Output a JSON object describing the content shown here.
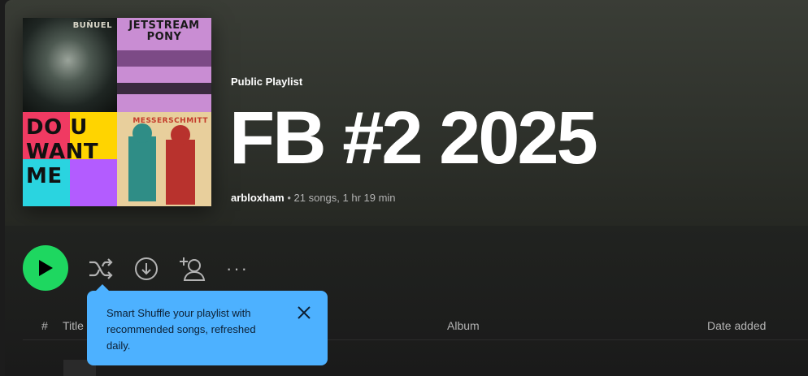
{
  "playlist": {
    "type_label": "Public Playlist",
    "title": "FB #2 2025",
    "owner": "arbloxham",
    "meta": " • 21 songs, 1 hr 19 min"
  },
  "cover": {
    "tile1_text": "BUÑUEL",
    "tile2_text_line1": "JETSTREAM",
    "tile2_text_line2": "PONY",
    "tile3_text": "DO U WANT ME",
    "tile4_text": "MESSERSCHMITT"
  },
  "actions": {
    "play_icon": "play-icon",
    "shuffle_icon": "shuffle-icon",
    "download_icon": "download-icon",
    "add_user_icon": "add-user-icon",
    "more_icon": "more-icon",
    "more_text": "···"
  },
  "tooltip": {
    "message": "Smart Shuffle your playlist with recommended songs, refreshed daily."
  },
  "table": {
    "columns": [
      "#",
      "Title",
      "Album",
      "Date added"
    ]
  },
  "colors": {
    "accent": "#1ed760",
    "tooltip_bg": "#4db1ff"
  }
}
